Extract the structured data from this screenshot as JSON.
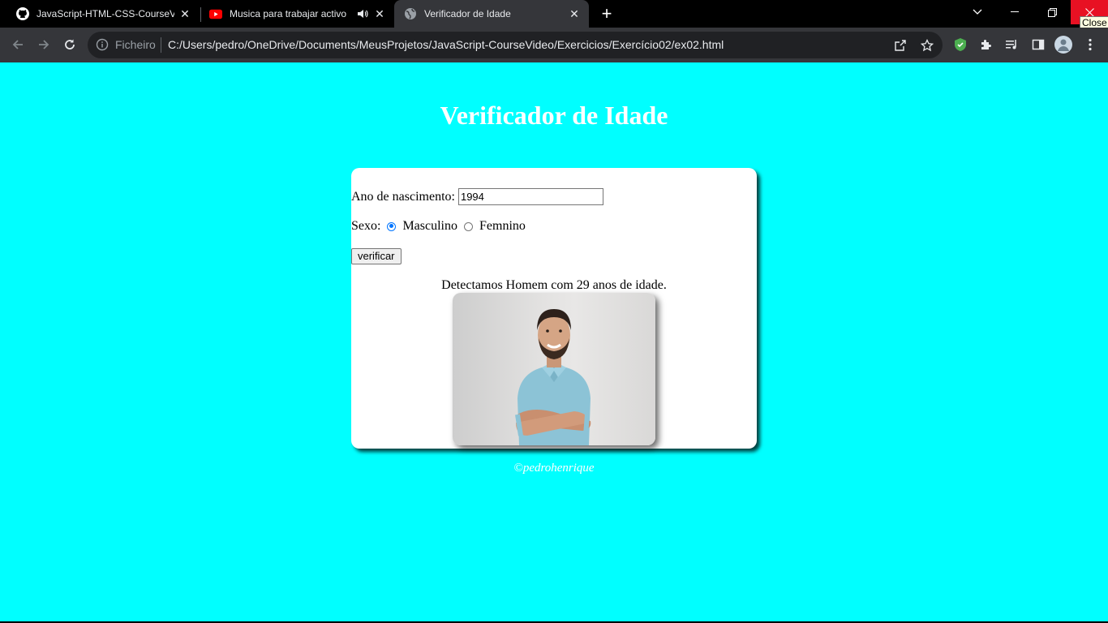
{
  "browser": {
    "tabs": [
      {
        "title": "JavaScript-HTML-CSS-CourseVideo",
        "icon": "github-icon",
        "active": false
      },
      {
        "title": "Musica para trabajar activo y alegre",
        "icon": "youtube-icon",
        "active": false,
        "audio": true
      },
      {
        "title": "Verificador de Idade",
        "icon": "globe-icon",
        "active": true
      }
    ],
    "new_tab_label": "+",
    "close_tooltip": "Close",
    "omnibox": {
      "scheme_label": "Ficheiro",
      "url": "C:/Users/pedro/OneDrive/Documents/MeusProjetos/JavaScript-CourseVideo/Exercicios/Exercício02/ex02.html"
    }
  },
  "page": {
    "title": "Verificador de Idade",
    "form": {
      "birth_year_label": "Ano de nascimento:",
      "birth_year_value": "1994",
      "sex_label": "Sexo:",
      "option_male": "Masculino",
      "option_female": "Femnino",
      "selected": "Masculino",
      "button_label": "verificar"
    },
    "result_text": "Detectamos Homem com 29 anos de idade.",
    "footer": "©pedrohenrique"
  },
  "colors": {
    "page_background": "#00ffff",
    "radio_accent": "#0075ff",
    "chrome_dark": "#35363a"
  }
}
